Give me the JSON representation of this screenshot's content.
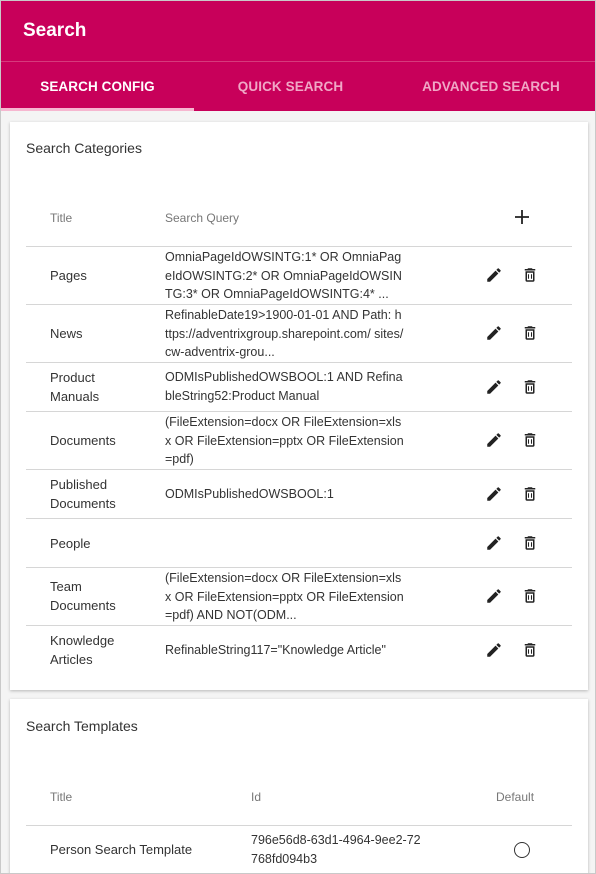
{
  "header": {
    "title": "Search"
  },
  "tabs": [
    {
      "label": "SEARCH CONFIG",
      "active": true
    },
    {
      "label": "QUICK SEARCH",
      "active": false
    },
    {
      "label": "ADVANCED SEARCH",
      "active": false
    }
  ],
  "categories": {
    "title": "Search Categories",
    "columns": {
      "title": "Title",
      "query": "Search Query"
    },
    "add_icon": "plus-icon",
    "rows": [
      {
        "title": "Pages",
        "query": "OmniaPageIdOWSINTG:1* OR OmniaPageIdOWSINTG:2* OR OmniaPageIdOWSINTG:3* OR OmniaPageIdOWSINTG:4* ..."
      },
      {
        "title": "News",
        "query": "RefinableDate19>1900-01-01 AND Path: https://adventrixgroup.sharepoint.com/ sites/cw-adventrix-grou..."
      },
      {
        "title": "Product Manuals",
        "query": "ODMIsPublishedOWSBOOL:1 AND RefinableString52:Product Manual"
      },
      {
        "title": "Documents",
        "query": "(FileExtension=docx OR FileExtension=xlsx OR FileExtension=pptx OR FileExtension=pdf)"
      },
      {
        "title": "Published Documents",
        "query": "ODMIsPublishedOWSBOOL:1"
      },
      {
        "title": "People",
        "query": ""
      },
      {
        "title": "Team Documents",
        "query": "(FileExtension=docx OR FileExtension=xlsx OR FileExtension=pptx OR FileExtension=pdf) AND NOT(ODM..."
      },
      {
        "title": "Knowledge Articles",
        "query": "RefinableString117=\"Knowledge Article\""
      }
    ]
  },
  "templates": {
    "title": "Search Templates",
    "columns": {
      "title": "Title",
      "id": "Id",
      "default": "Default"
    },
    "rows": [
      {
        "title": "Person Search Template",
        "id": "796e56d8-63d1-4964-9ee2-72768fd094b3",
        "default": false
      }
    ]
  },
  "colors": {
    "brand": "#c8005a",
    "tab_inactive": "#f0a8c6",
    "tab_indicator": "#f6b7d0"
  }
}
